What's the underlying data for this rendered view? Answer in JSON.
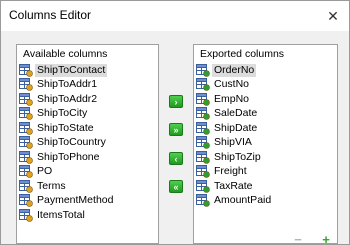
{
  "window": {
    "title": "Columns Editor",
    "close_glyph": "✕"
  },
  "available": {
    "header": "Available columns",
    "items": [
      {
        "label": "ShipToContact",
        "icon": "field-icon",
        "selected": true
      },
      {
        "label": "ShipToAddr1",
        "icon": "field-icon"
      },
      {
        "label": "ShipToAddr2",
        "icon": "field-icon"
      },
      {
        "label": "ShipToCity",
        "icon": "field-icon"
      },
      {
        "label": "ShipToState",
        "icon": "field-icon"
      },
      {
        "label": "ShipToCountry",
        "icon": "field-icon"
      },
      {
        "label": "ShipToPhone",
        "icon": "field-icon"
      },
      {
        "label": "PO",
        "icon": "field-icon"
      },
      {
        "label": "Terms",
        "icon": "field-icon"
      },
      {
        "label": "PaymentMethod",
        "icon": "field-icon"
      },
      {
        "label": "ItemsTotal",
        "icon": "field-icon"
      }
    ]
  },
  "exported": {
    "header": "Exported columns",
    "items": [
      {
        "label": "OrderNo",
        "icon": "field-export-icon",
        "selected": true
      },
      {
        "label": "CustNo",
        "icon": "field-export-icon"
      },
      {
        "label": "EmpNo",
        "icon": "field-export-icon"
      },
      {
        "label": "SaleDate",
        "icon": "field-export-icon"
      },
      {
        "label": "ShipDate",
        "icon": "field-export-icon"
      },
      {
        "label": "ShipVIA",
        "icon": "field-export-icon"
      },
      {
        "label": "ShipToZip",
        "icon": "field-export-icon"
      },
      {
        "label": "Freight",
        "icon": "field-export-icon"
      },
      {
        "label": "TaxRate",
        "icon": "field-export-icon"
      },
      {
        "label": "AmountPaid",
        "icon": "field-export-icon"
      }
    ]
  },
  "buttons": {
    "add_one": {
      "glyph": "›",
      "icon": "arrow-right-icon"
    },
    "add_all": {
      "glyph": "»",
      "icon": "double-arrow-right-icon"
    },
    "remove_one": {
      "glyph": "‹",
      "icon": "arrow-left-icon"
    },
    "remove_all": {
      "glyph": "«",
      "icon": "double-arrow-left-icon"
    },
    "remove_column": {
      "glyph": "−",
      "icon": "minus-icon"
    },
    "add_column": {
      "glyph": "+",
      "icon": "plus-icon"
    }
  },
  "colors": {
    "accent_green": "#2ea82e",
    "selection": "#dcdcdc",
    "disabled": "#b5b5b5"
  }
}
